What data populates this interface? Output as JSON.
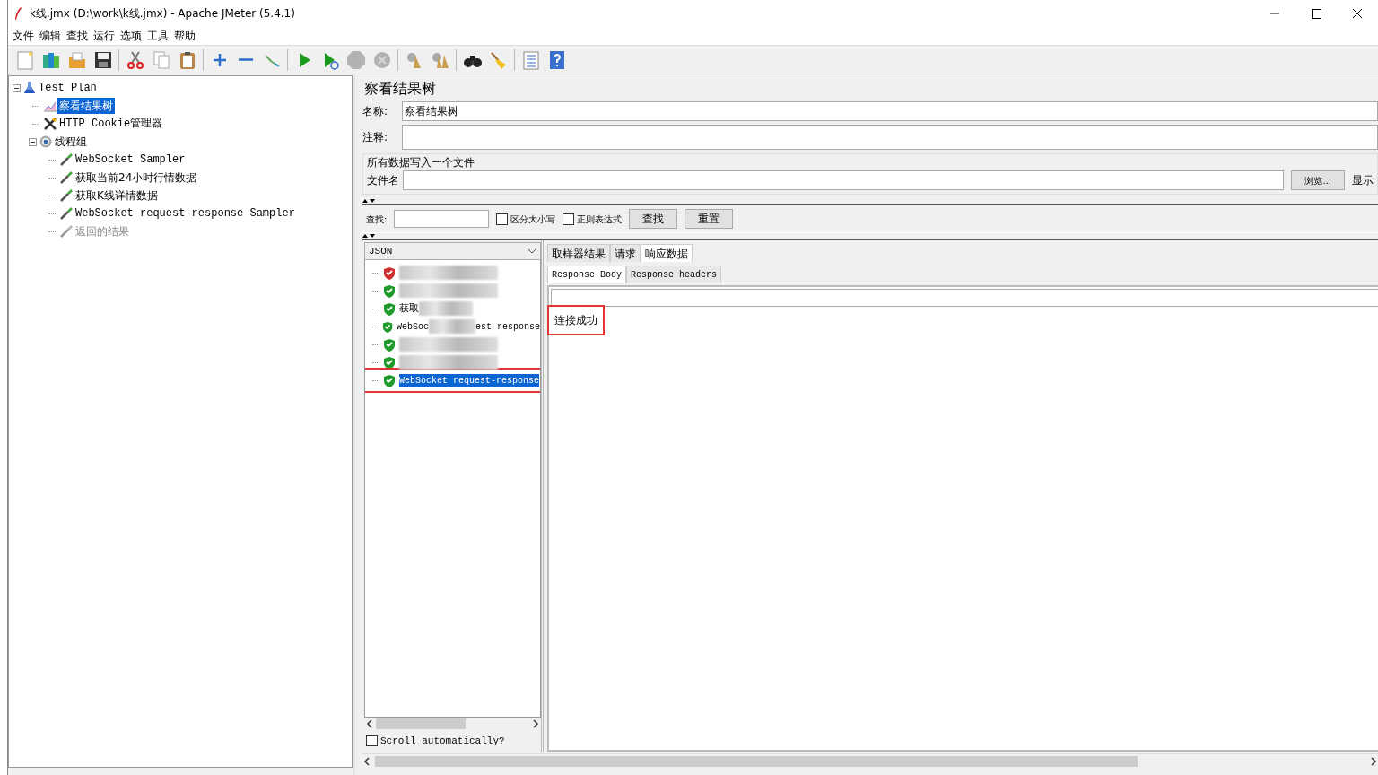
{
  "window": {
    "title": "k线.jmx (D:\\work\\k线.jmx) - Apache JMeter (5.4.1)"
  },
  "menu": [
    "文件",
    "编辑",
    "查找",
    "运行",
    "选项",
    "工具",
    "帮助"
  ],
  "toolbar": [
    [
      {
        "kind": "new",
        "disabled": false
      },
      {
        "kind": "templates",
        "disabled": false
      },
      {
        "kind": "open",
        "disabled": false
      },
      {
        "kind": "save",
        "disabled": false
      }
    ],
    [
      {
        "kind": "cut",
        "disabled": false
      },
      {
        "kind": "copy",
        "disabled": false
      },
      {
        "kind": "paste",
        "disabled": false
      }
    ],
    [
      {
        "kind": "expand",
        "disabled": false
      },
      {
        "kind": "collapse",
        "disabled": false
      },
      {
        "kind": "toggle",
        "disabled": false
      }
    ],
    [
      {
        "kind": "start",
        "disabled": false
      },
      {
        "kind": "start_no_timers",
        "disabled": false
      },
      {
        "kind": "stop",
        "disabled": true
      },
      {
        "kind": "shutdown",
        "disabled": true
      }
    ],
    [
      {
        "kind": "clear",
        "disabled": false
      },
      {
        "kind": "clear_all",
        "disabled": false
      }
    ],
    [
      {
        "kind": "search",
        "disabled": false
      },
      {
        "kind": "reset_search",
        "disabled": false
      }
    ],
    [
      {
        "kind": "functions",
        "disabled": false
      },
      {
        "kind": "help",
        "disabled": false
      }
    ]
  ],
  "tree": [
    {
      "label": "Test Plan",
      "kind": "plan",
      "selected": false,
      "disabled": false,
      "expanded": true,
      "children": [
        {
          "label": "察看结果树",
          "kind": "listener",
          "selected": true,
          "disabled": false
        },
        {
          "label": "HTTP Cookie管理器",
          "kind": "config",
          "selected": false,
          "disabled": false
        },
        {
          "label": "线程组",
          "kind": "threadgroup",
          "selected": false,
          "disabled": false,
          "expanded": true,
          "children": [
            {
              "label": "WebSocket Sampler",
              "kind": "sampler",
              "selected": false,
              "disabled": false
            },
            {
              "label": "获取当前24小时行情数据",
              "kind": "sampler",
              "selected": false,
              "disabled": false
            },
            {
              "label": "获取K线详情数据",
              "kind": "sampler",
              "selected": false,
              "disabled": false
            },
            {
              "label": "WebSocket request-response Sampler",
              "kind": "sampler",
              "selected": false,
              "disabled": false
            },
            {
              "label": "返回的结果",
              "kind": "sampler",
              "selected": false,
              "disabled": true
            }
          ]
        }
      ]
    }
  ],
  "panel": {
    "title": "察看结果树",
    "name_label": "名称:",
    "name_value": "察看结果树",
    "comment_label": "注释:",
    "file_group": "所有数据写入一个文件",
    "file_label": "文件名",
    "browse_button": "浏览...",
    "display_label": "显示",
    "search_label": "查找:",
    "case_option": {
      "label": "区分大小写",
      "checked": false
    },
    "regex_option": {
      "label": "正则表达式",
      "checked": false
    },
    "find_button": "查找",
    "reset_button": "重置"
  },
  "results": {
    "renderer": "JSON",
    "items": [
      {
        "redacted": true,
        "kind": "failed",
        "selected": false,
        "highlighted": false
      },
      {
        "redacted": true,
        "kind": "ok",
        "selected": false,
        "highlighted": false
      },
      {
        "label": "获取",
        "redacted": true,
        "kind": "ok",
        "selected": false,
        "highlighted": false
      },
      {
        "label": "WebSoc",
        "tail": "est-response",
        "redacted": true,
        "kind": "ok",
        "selected": false,
        "highlighted": false
      },
      {
        "redacted": true,
        "kind": "ok",
        "selected": false,
        "highlighted": false
      },
      {
        "redacted": true,
        "kind": "ok",
        "selected": false,
        "highlighted": false
      },
      {
        "label": "WebSocket request-response",
        "redacted": false,
        "kind": "ok",
        "selected": true,
        "highlighted": true
      }
    ],
    "scroll_auto": {
      "label": "Scroll automatically?",
      "checked": false
    }
  },
  "tabs": [
    {
      "label": "取样器结果",
      "selected": false
    },
    {
      "label": "请求",
      "selected": false
    },
    {
      "label": "响应数据",
      "selected": true
    }
  ],
  "subtabs": [
    {
      "label": "Response Body",
      "selected": true
    },
    {
      "label": "Response headers",
      "selected": false
    }
  ],
  "response": {
    "text": "连接成功",
    "highlighted": true
  }
}
